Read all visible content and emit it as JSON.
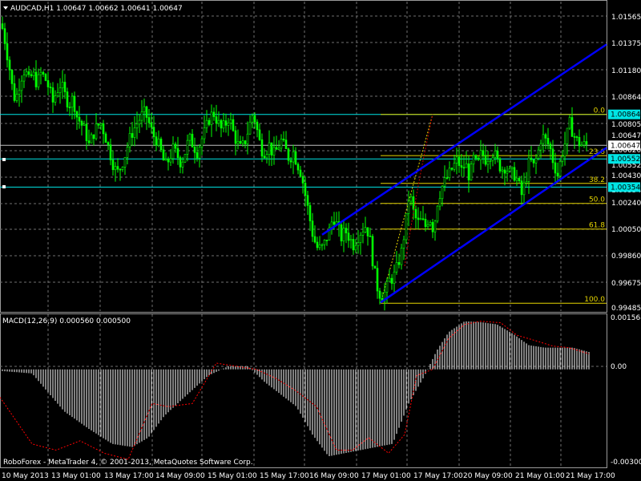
{
  "symbol_header": "AUDCAD,H1  1.00647 1.00662 1.00641 1.00647",
  "macd_header": "MACD(12,26,9) 0.000560 0.000500",
  "copyright": "RoboForex - MetaTrader 4, © 2001-2013, MetaQuotes Software Corp.",
  "colors": {
    "background": "#000000",
    "grid": "#6f6f6f",
    "candle": "#00ff00",
    "channel": "#0000ff",
    "fibo": "#e6d600",
    "hline": "#00e5e5",
    "macd_hist": "#ffffff",
    "macd_signal": "#ff0000",
    "axis_text": "#ffffff"
  },
  "price_axis": {
    "labels": [
      "1.01565",
      "1.01375",
      "1.01180",
      "1.00864",
      "1.00805",
      "1.00647",
      "1.00620",
      "1.00552",
      "1.00430",
      "1.00354",
      "1.00240",
      "1.00050",
      "0.99860",
      "0.99675",
      "0.99485"
    ]
  },
  "price_badges": [
    {
      "name": "hline-upper",
      "value": "1.00864",
      "price": 1.00864
    },
    {
      "name": "current-price",
      "value": "1.00647",
      "price": 1.00647
    },
    {
      "name": "hline-middle",
      "value": "1.00552",
      "price": 1.00552
    },
    {
      "name": "hline-lower",
      "value": "1.00354",
      "price": 1.00354
    }
  ],
  "fibonacci": {
    "levels": [
      {
        "label": "0.0",
        "price": 1.00864
      },
      {
        "label": "23.6",
        "price": 1.00575
      },
      {
        "label": "38.2",
        "price": 1.0038
      },
      {
        "label": "50.0",
        "price": 1.0024
      },
      {
        "label": "61.8",
        "price": 1.0006
      },
      {
        "label": "100.0",
        "price": 0.9954
      }
    ]
  },
  "macd_axis": {
    "labels": [
      "0.001568",
      "0.00",
      "-0.003001"
    ]
  },
  "time_axis": {
    "labels": [
      "10 May 2013",
      "13 May 01:00",
      "13 May 17:00",
      "14 May 09:00",
      "15 May 01:00",
      "15 May 17:00",
      "16 May 09:00",
      "17 May 01:00",
      "17 May 17:00",
      "20 May 09:00",
      "21 May 01:00",
      "21 May 17:00"
    ]
  },
  "chart_data": {
    "type": "candlestick",
    "symbol": "AUDCAD",
    "timeframe": "H1",
    "ohlc_current": {
      "open": 1.00647,
      "high": 1.00662,
      "low": 1.00641,
      "close": 1.00647
    },
    "price_range": [
      0.99485,
      1.01565
    ],
    "close_path": [
      [
        0,
        1.015
      ],
      [
        3,
        1.0145
      ],
      [
        6,
        1.0135
      ],
      [
        9,
        1.0125
      ],
      [
        12,
        1.0115
      ],
      [
        16,
        1.0098
      ],
      [
        20,
        1.01
      ],
      [
        25,
        1.0112
      ],
      [
        30,
        1.0118
      ],
      [
        35,
        1.011
      ],
      [
        40,
        1.0115
      ],
      [
        45,
        1.0108
      ],
      [
        50,
        1.0115
      ],
      [
        55,
        1.0112
      ],
      [
        60,
        1.0105
      ],
      [
        65,
        1.0095
      ],
      [
        70,
        1.0103
      ],
      [
        75,
        1.0108
      ],
      [
        80,
        1.01
      ],
      [
        85,
        1.0093
      ],
      [
        90,
        1.0098
      ],
      [
        95,
        1.0085
      ],
      [
        100,
        1.008
      ],
      [
        105,
        1.0075
      ],
      [
        110,
        1.0065
      ],
      [
        115,
        1.0072
      ],
      [
        120,
        1.0078
      ],
      [
        125,
        1.008
      ],
      [
        130,
        1.0072
      ],
      [
        135,
        1.0062
      ],
      [
        140,
        1.0052
      ],
      [
        145,
        1.0045
      ],
      [
        150,
        1.005
      ],
      [
        155,
        1.0058
      ],
      [
        160,
        1.0068
      ],
      [
        165,
        1.0075
      ],
      [
        170,
        1.008
      ],
      [
        175,
        1.0085
      ],
      [
        180,
        1.0088
      ],
      [
        185,
        1.008
      ],
      [
        190,
        1.0072
      ],
      [
        195,
        1.0068
      ],
      [
        200,
        1.006
      ],
      [
        205,
        1.005
      ],
      [
        210,
        1.0055
      ],
      [
        215,
        1.0062
      ],
      [
        220,
        1.0058
      ],
      [
        225,
        1.0052
      ],
      [
        230,
        1.006
      ],
      [
        235,
        1.007
      ],
      [
        240,
        1.0065
      ],
      [
        245,
        1.006
      ],
      [
        250,
        1.0068
      ],
      [
        255,
        1.0075
      ],
      [
        260,
        1.0083
      ],
      [
        265,
        1.0088
      ],
      [
        270,
        1.0082
      ],
      [
        275,
        1.0076
      ],
      [
        280,
        1.0079
      ],
      [
        285,
        1.0085
      ],
      [
        290,
        1.0074
      ],
      [
        295,
        1.0066
      ],
      [
        300,
        1.0062
      ],
      [
        305,
        1.0068
      ],
      [
        310,
        1.0078
      ],
      [
        315,
        1.0088
      ],
      [
        320,
        1.0075
      ],
      [
        325,
        1.0062
      ],
      [
        330,
        1.006
      ],
      [
        335,
        1.0065
      ],
      [
        340,
        1.0058
      ],
      [
        345,
        1.0062
      ],
      [
        350,
        1.0068
      ],
      [
        355,
        1.0062
      ],
      [
        360,
        1.0055
      ],
      [
        365,
        1.006
      ],
      [
        370,
        1.0052
      ],
      [
        375,
        1.0045
      ],
      [
        380,
        1.003
      ],
      [
        385,
        1.0015
      ],
      [
        390,
        1.0
      ],
      [
        395,
        0.9993
      ],
      [
        400,
        0.9992
      ],
      [
        405,
        0.9997
      ],
      [
        410,
        1.0005
      ],
      [
        415,
        1.0015
      ],
      [
        420,
        1.0008
      ],
      [
        425,
        1.0
      ],
      [
        430,
        1.0005
      ],
      [
        435,
        1.0
      ],
      [
        440,
        0.9995
      ],
      [
        445,
        1.0
      ],
      [
        450,
        1.0005
      ],
      [
        455,
        1.0008
      ],
      [
        460,
        1.0002
      ],
      [
        465,
        0.998
      ],
      [
        470,
        0.9965
      ],
      [
        475,
        0.9958
      ],
      [
        480,
        0.9962
      ],
      [
        485,
        0.997
      ],
      [
        490,
        0.9972
      ],
      [
        495,
        0.998
      ],
      [
        500,
        0.999
      ],
      [
        505,
        1.0008
      ],
      [
        510,
        1.0032
      ],
      [
        515,
        1.0018
      ],
      [
        520,
        1.001
      ],
      [
        525,
        1.0012
      ],
      [
        530,
        1.0008
      ],
      [
        535,
        1.0015
      ],
      [
        540,
        1.0005
      ],
      [
        545,
        1.0025
      ],
      [
        550,
        1.0035
      ],
      [
        555,
        1.004
      ],
      [
        560,
        1.0045
      ],
      [
        565,
        1.005
      ],
      [
        570,
        1.0055
      ],
      [
        575,
        1.0047
      ],
      [
        580,
        1.0052
      ],
      [
        585,
        1.0042
      ],
      [
        590,
        1.0055
      ],
      [
        595,
        1.005
      ],
      [
        600,
        1.006
      ],
      [
        605,
        1.0055
      ],
      [
        610,
        1.0058
      ],
      [
        615,
        1.006
      ],
      [
        620,
        1.0053
      ],
      [
        625,
        1.0048
      ],
      [
        630,
        1.005
      ],
      [
        635,
        1.0045
      ],
      [
        640,
        1.0045
      ],
      [
        645,
        1.004
      ],
      [
        650,
        1.003
      ],
      [
        655,
        1.004
      ],
      [
        660,
        1.0055
      ],
      [
        665,
        1.005
      ],
      [
        670,
        1.0058
      ],
      [
        675,
        1.0072
      ],
      [
        680,
        1.0068
      ],
      [
        685,
        1.0064
      ],
      [
        690,
        1.0052
      ],
      [
        695,
        1.0044
      ],
      [
        700,
        1.0058
      ],
      [
        705,
        1.0068
      ],
      [
        710,
        1.008
      ],
      [
        715,
        1.0072
      ],
      [
        720,
        1.0067
      ],
      [
        725,
        1.0065
      ],
      [
        730,
        1.0065
      ]
    ],
    "channel_lines": [
      [
        [
          402,
          1.0002
        ],
        [
          757,
          1.01355
        ]
      ],
      [
        [
          475,
          0.99545
        ],
        [
          757,
          1.0063
        ]
      ]
    ],
    "macd_range": [
      -0.003001,
      0.001568
    ],
    "macd_histogram_path": [
      [
        0,
        -5e-05
      ],
      [
        40,
        -0.00013
      ],
      [
        80,
        -0.00135
      ],
      [
        110,
        -0.0019
      ],
      [
        140,
        -0.0024
      ],
      [
        165,
        -0.0025
      ],
      [
        185,
        -0.0022
      ],
      [
        205,
        -0.0015
      ],
      [
        230,
        -0.0009
      ],
      [
        260,
        -0.0002
      ],
      [
        285,
        0.0001
      ],
      [
        310,
        0.0001
      ],
      [
        330,
        -0.0004
      ],
      [
        350,
        -0.0008
      ],
      [
        370,
        -0.0012
      ],
      [
        390,
        -0.0021
      ],
      [
        410,
        -0.0028
      ],
      [
        430,
        -0.0027
      ],
      [
        450,
        -0.0026
      ],
      [
        470,
        -0.0025
      ],
      [
        490,
        -0.0024
      ],
      [
        510,
        -0.0011
      ],
      [
        530,
        -0.0002
      ],
      [
        545,
        0.0006
      ],
      [
        560,
        0.0012
      ],
      [
        580,
        0.00155
      ],
      [
        600,
        0.00152
      ],
      [
        620,
        0.00145
      ],
      [
        640,
        0.00115
      ],
      [
        660,
        0.00078
      ],
      [
        680,
        0.0007
      ],
      [
        700,
        0.0007
      ],
      [
        715,
        0.0007
      ],
      [
        735,
        0.00056
      ]
    ],
    "macd_signal_path": [
      [
        0,
        -0.0009
      ],
      [
        40,
        -0.0024
      ],
      [
        70,
        -0.0026
      ],
      [
        100,
        -0.0023
      ],
      [
        130,
        -0.0027
      ],
      [
        160,
        -0.0029
      ],
      [
        190,
        -0.0011
      ],
      [
        210,
        -0.0012
      ],
      [
        240,
        -0.0011
      ],
      [
        270,
        0.0002
      ],
      [
        295,
        0.0001
      ],
      [
        320,
        0.0
      ],
      [
        345,
        -0.0003
      ],
      [
        370,
        -0.0007
      ],
      [
        395,
        -0.0012
      ],
      [
        420,
        -0.0026
      ],
      [
        440,
        -0.0026
      ],
      [
        460,
        -0.0022
      ],
      [
        485,
        -0.0027
      ],
      [
        505,
        -0.0021
      ],
      [
        520,
        -0.0002
      ],
      [
        540,
        0.0
      ],
      [
        560,
        0.001
      ],
      [
        580,
        0.00145
      ],
      [
        600,
        0.00155
      ],
      [
        625,
        0.0015
      ],
      [
        645,
        0.0011
      ],
      [
        665,
        0.00095
      ],
      [
        690,
        0.00075
      ],
      [
        710,
        0.0007
      ],
      [
        735,
        0.0005
      ]
    ]
  }
}
